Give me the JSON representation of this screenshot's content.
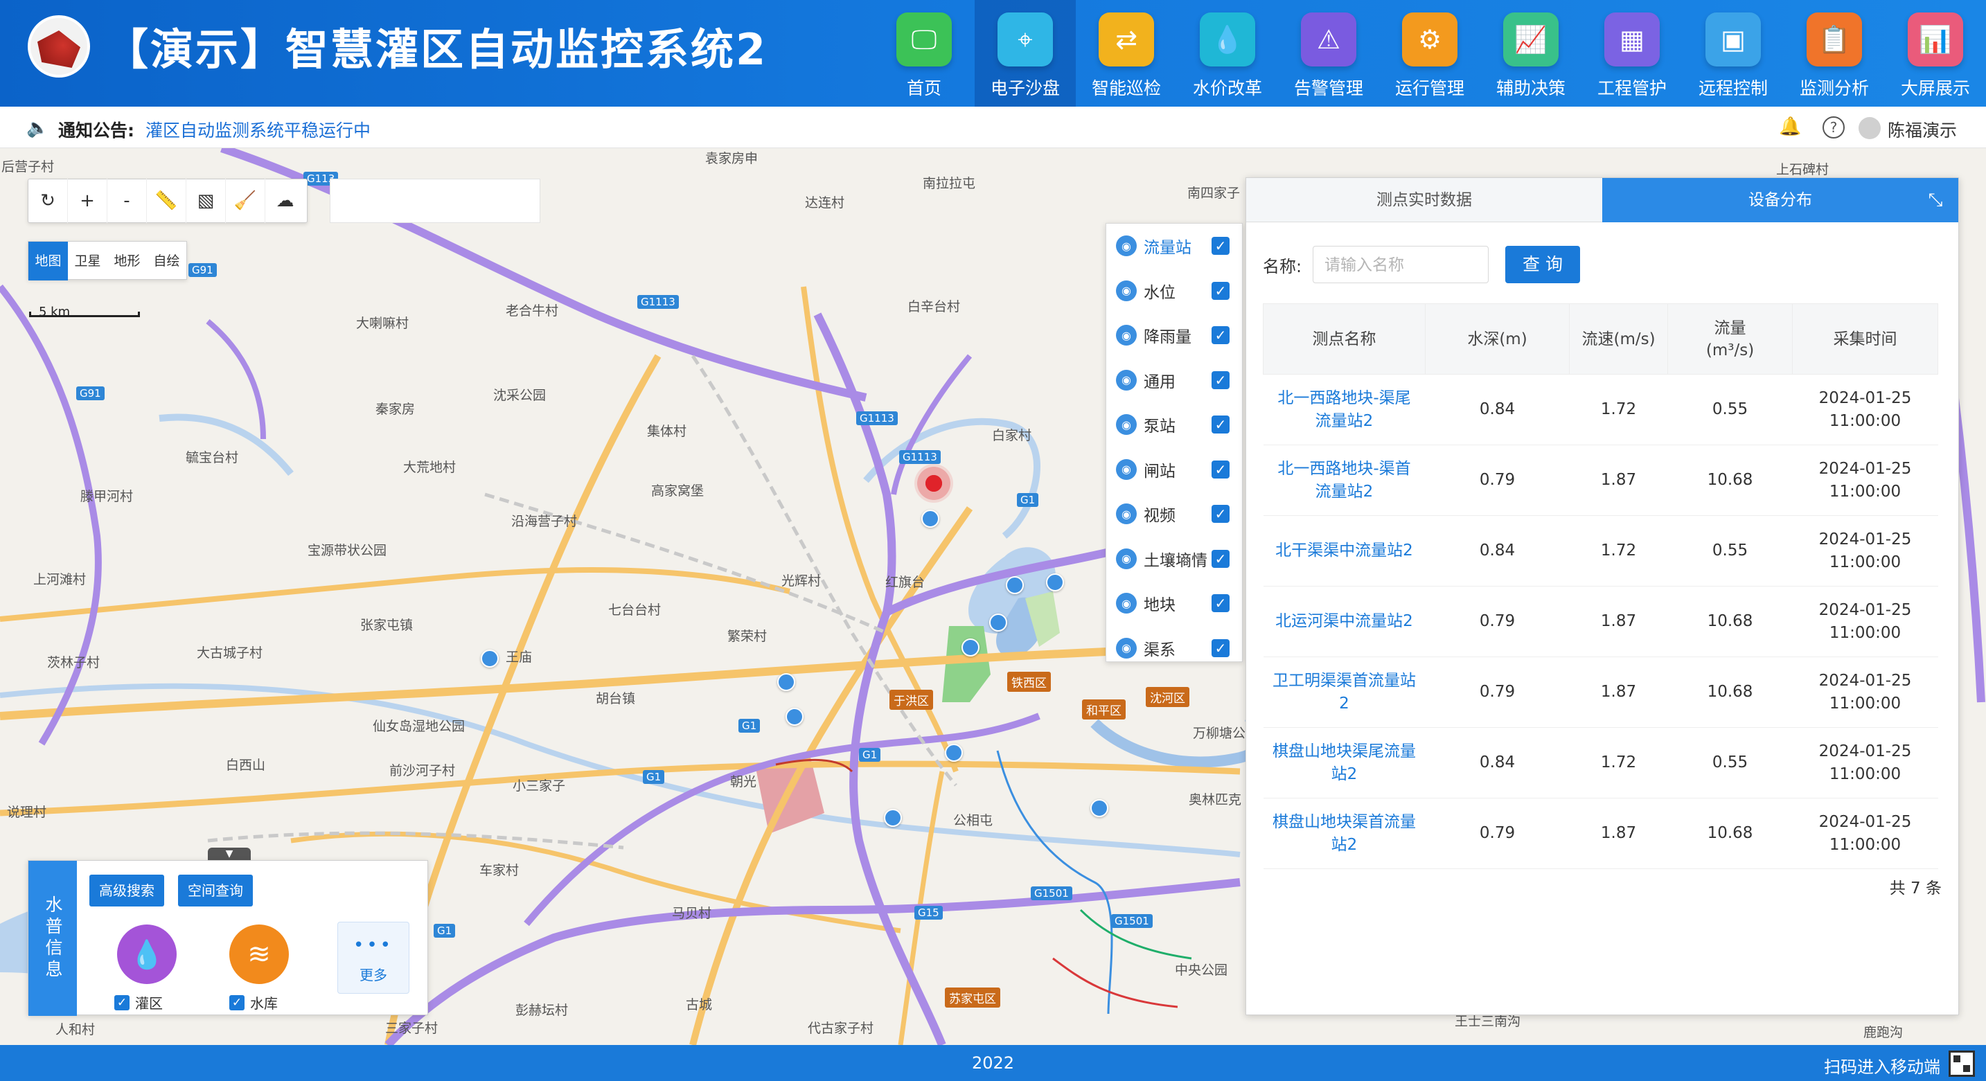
{
  "header": {
    "title": "【演示】智慧灌区自动监控系统2",
    "logo_text": "",
    "nav": [
      {
        "label": "首页",
        "icon": "monitor-icon",
        "color": "#3cc257",
        "glyph": "🖵",
        "active": false
      },
      {
        "label": "电子沙盘",
        "icon": "map-pin-icon",
        "color": "#2fb6e6",
        "glyph": "⌖",
        "active": true
      },
      {
        "label": "智能巡检",
        "icon": "route-icon",
        "color": "#f2b21d",
        "glyph": "⇄",
        "active": false
      },
      {
        "label": "水价改革",
        "icon": "water-drop-icon",
        "color": "#1fb7d6",
        "glyph": "💧",
        "active": false
      },
      {
        "label": "告警管理",
        "icon": "alarm-icon",
        "color": "#7a5be0",
        "glyph": "⚠",
        "active": false
      },
      {
        "label": "运行管理",
        "icon": "network-icon",
        "color": "#f39a1e",
        "glyph": "⚙",
        "active": false
      },
      {
        "label": "辅助决策",
        "icon": "trend-chart-icon",
        "color": "#39c18a",
        "glyph": "📈",
        "active": false
      },
      {
        "label": "工程管护",
        "icon": "dashboard-icon",
        "color": "#7b63e3",
        "glyph": "▦",
        "active": false
      },
      {
        "label": "远程控制",
        "icon": "remote-control-icon",
        "color": "#3ba3e8",
        "glyph": "▣",
        "active": false
      },
      {
        "label": "监测分析",
        "icon": "report-icon",
        "color": "#f0742a",
        "glyph": "📋",
        "active": false
      },
      {
        "label": "大屏展示",
        "icon": "big-screen-icon",
        "color": "#ea5b7b",
        "glyph": "📊",
        "active": false
      }
    ]
  },
  "notice": {
    "label": "通知公告:",
    "text": "灌区自动监测系统平稳运行中",
    "user": "陈福演示"
  },
  "map": {
    "toolbar": [
      {
        "name": "refresh-icon",
        "glyph": "↻"
      },
      {
        "name": "zoom-in-icon",
        "glyph": "+"
      },
      {
        "name": "zoom-out-icon",
        "glyph": "-"
      },
      {
        "name": "measure-ruler-icon",
        "glyph": "📏"
      },
      {
        "name": "area-measure-icon",
        "glyph": "▧"
      },
      {
        "name": "clear-brush-icon",
        "glyph": "🧹"
      },
      {
        "name": "weather-icon",
        "glyph": "☁"
      }
    ],
    "types": [
      {
        "label": "地图",
        "active": true
      },
      {
        "label": "卫星",
        "active": false
      },
      {
        "label": "地形",
        "active": false
      },
      {
        "label": "自绘",
        "active": false
      }
    ],
    "scale": "5 km",
    "labels": [
      {
        "text": "后营子村"
      },
      {
        "text": "袁家房申"
      },
      {
        "text": "南拉拉屯"
      },
      {
        "text": "南四家子"
      },
      {
        "text": "达连村"
      },
      {
        "text": "白辛台村"
      },
      {
        "text": "老合牛村"
      },
      {
        "text": "大喇嘛村"
      },
      {
        "text": "沈采公园"
      },
      {
        "text": "秦家房"
      },
      {
        "text": "集体村"
      },
      {
        "text": "白家村"
      },
      {
        "text": "毓宝台村"
      },
      {
        "text": "大荒地村"
      },
      {
        "text": "高家窝堡"
      },
      {
        "text": "滕甲河村"
      },
      {
        "text": "沿海营子村"
      },
      {
        "text": "宝源带状公园"
      },
      {
        "text": "上河滩村"
      },
      {
        "text": "光辉村"
      },
      {
        "text": "红旗台"
      },
      {
        "text": "七台台村"
      },
      {
        "text": "张家屯镇"
      },
      {
        "text": "繁荣村"
      },
      {
        "text": "茨林子村"
      },
      {
        "text": "大古城子村"
      },
      {
        "text": "王庙"
      },
      {
        "text": "胡台镇"
      },
      {
        "text": "仙女岛湿地公园"
      },
      {
        "text": "白西山"
      },
      {
        "text": "前沙河子村"
      },
      {
        "text": "小三家子"
      },
      {
        "text": "朝光"
      },
      {
        "text": "公相屯"
      },
      {
        "text": "说理村"
      },
      {
        "text": "车家村"
      },
      {
        "text": "马贝村"
      },
      {
        "text": "古城"
      },
      {
        "text": "彭赫坛村"
      },
      {
        "text": "三家子村"
      },
      {
        "text": "人和村"
      },
      {
        "text": "代古家子村"
      },
      {
        "text": "中央公园"
      },
      {
        "text": "奥林匹克"
      },
      {
        "text": "万柳塘公"
      },
      {
        "text": "鹿跑沟"
      },
      {
        "text": "上石碑村"
      },
      {
        "text": "王士三南沟"
      }
    ],
    "road_badges": [
      "G113",
      "G1113",
      "G1113",
      "G1113",
      "G1",
      "G1",
      "G1",
      "G1",
      "G15",
      "G1501",
      "G1501",
      "G91",
      "G91",
      "G1"
    ],
    "districts": [
      "于洪区",
      "铁西区",
      "和平区",
      "沈河区",
      "苏家屯区"
    ],
    "layers": [
      {
        "label": "流量站",
        "icon": "flow-station-icon",
        "active": true
      },
      {
        "label": "水位",
        "icon": "water-level-icon",
        "active": false
      },
      {
        "label": "降雨量",
        "icon": "rainfall-icon",
        "active": false
      },
      {
        "label": "通用",
        "icon": "general-icon",
        "active": false
      },
      {
        "label": "泵站",
        "icon": "pump-station-icon",
        "active": false
      },
      {
        "label": "闸站",
        "icon": "gate-station-icon",
        "active": false
      },
      {
        "label": "视频",
        "icon": "video-icon",
        "active": false
      },
      {
        "label": "土壤墒情",
        "icon": "soil-moisture-icon",
        "active": false
      },
      {
        "label": "地块",
        "icon": "land-parcel-icon",
        "active": false
      },
      {
        "label": "渠系",
        "icon": "canal-system-icon",
        "active": false
      }
    ]
  },
  "panel": {
    "tabs": [
      {
        "label": "测点实时数据",
        "active": false
      },
      {
        "label": "设备分布",
        "active": true
      }
    ],
    "name_label": "名称:",
    "name_placeholder": "请输入名称",
    "query_label": "查 询",
    "columns": [
      "测点名称",
      "水深(m)",
      "流速(m/s)",
      "流量\n(m³/s)",
      "采集时间"
    ],
    "rows": [
      {
        "name": "北一西路地块-渠尾流量站2",
        "depth": "0.84",
        "speed": "1.72",
        "flow": "0.55",
        "time": "2024-01-25\n11:00:00"
      },
      {
        "name": "北一西路地块-渠首流量站2",
        "depth": "0.79",
        "speed": "1.87",
        "flow": "10.68",
        "time": "2024-01-25\n11:00:00"
      },
      {
        "name": "北干渠渠中流量站2",
        "depth": "0.84",
        "speed": "1.72",
        "flow": "0.55",
        "time": "2024-01-25\n11:00:00"
      },
      {
        "name": "北运河渠中流量站2",
        "depth": "0.79",
        "speed": "1.87",
        "flow": "10.68",
        "time": "2024-01-25\n11:00:00"
      },
      {
        "name": "卫工明渠渠首流量站2",
        "depth": "0.79",
        "speed": "1.87",
        "flow": "10.68",
        "time": "2024-01-25\n11:00:00"
      },
      {
        "name": "棋盘山地块渠尾流量站2",
        "depth": "0.84",
        "speed": "1.72",
        "flow": "0.55",
        "time": "2024-01-25\n11:00:00"
      },
      {
        "name": "棋盘山地块渠首流量站2",
        "depth": "0.79",
        "speed": "1.87",
        "flow": "10.68",
        "time": "2024-01-25\n11:00:00"
      }
    ],
    "total": "共 7 条"
  },
  "water_panel": {
    "title": "水普信息",
    "buttons": [
      "高级搜索",
      "空间查询"
    ],
    "items": [
      {
        "label": "灌区",
        "icon": "irrigation-district-icon",
        "color": "#a454d8",
        "glyph": "💧"
      },
      {
        "label": "水库",
        "icon": "reservoir-icon",
        "color": "#f28a1c",
        "glyph": "≋"
      }
    ],
    "more_label": "更多"
  },
  "footer": {
    "year": "2022",
    "qr_text": "扫码进入移动端"
  }
}
